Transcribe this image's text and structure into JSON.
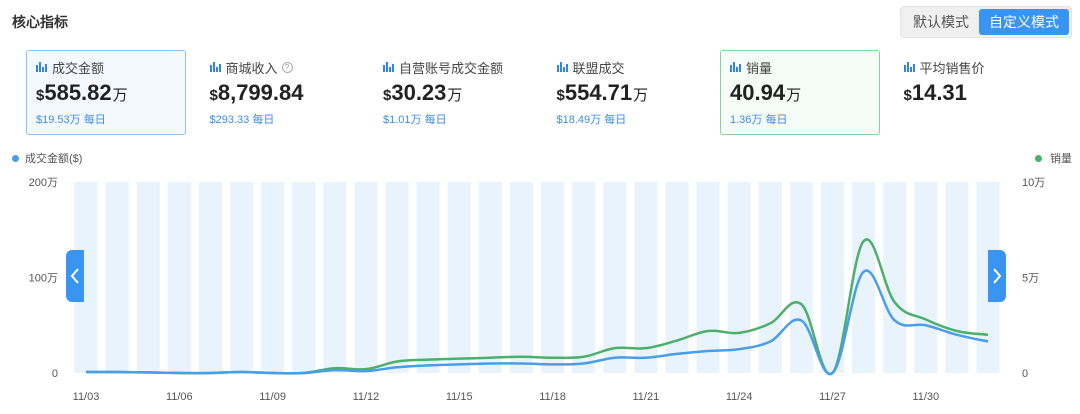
{
  "header": {
    "title": "核心指标"
  },
  "modes": [
    {
      "label": "默认模式",
      "active": false
    },
    {
      "label": "自定义模式",
      "active": true
    }
  ],
  "metrics": [
    {
      "label": "成交金额",
      "currency": "$",
      "value": "585.82",
      "unit": "万",
      "sub": "$19.53万 每日",
      "selected": "blue",
      "help": false
    },
    {
      "label": "商城收入",
      "currency": "$",
      "value": "8,799.84",
      "unit": "",
      "sub": "$293.33 每日",
      "selected": "",
      "help": true
    },
    {
      "label": "自营账号成交金额",
      "currency": "$",
      "value": "30.23",
      "unit": "万",
      "sub": "$1.01万 每日",
      "selected": "",
      "help": false
    },
    {
      "label": "联盟成交",
      "currency": "$",
      "value": "554.71",
      "unit": "万",
      "sub": "$18.49万 每日",
      "selected": "",
      "help": false
    },
    {
      "label": "销量",
      "currency": "",
      "value": "40.94",
      "unit": "万",
      "sub": "1.36万 每日",
      "selected": "green",
      "help": false
    },
    {
      "label": "平均销售价",
      "currency": "$",
      "value": "14.31",
      "unit": "",
      "sub": "",
      "selected": "",
      "help": false
    }
  ],
  "legend": {
    "left": {
      "label": "成交金额($)",
      "color": "#4a9de8"
    },
    "right": {
      "label": "销量",
      "color": "#4caf6a"
    }
  },
  "icons": {
    "metric": "bar-chart-icon",
    "help": "question-circle-icon",
    "prev": "chevron-left-icon",
    "next": "chevron-right-icon"
  },
  "chart_data": {
    "type": "line",
    "x": [
      "11/03",
      "11/04",
      "11/05",
      "11/06",
      "11/07",
      "11/08",
      "11/09",
      "11/10",
      "11/11",
      "11/12",
      "11/13",
      "11/14",
      "11/15",
      "11/16",
      "11/17",
      "11/18",
      "11/19",
      "11/20",
      "11/21",
      "11/22",
      "11/23",
      "11/24",
      "11/25",
      "11/26",
      "11/27",
      "11/28",
      "11/29",
      "11/30",
      "12/01",
      "12/02"
    ],
    "x_tick_labels": [
      "11/03",
      "11/06",
      "11/09",
      "11/12",
      "11/15",
      "11/18",
      "11/21",
      "11/24",
      "11/27",
      "11/30"
    ],
    "y_left": {
      "label": "成交金额($)",
      "ticks": [
        "0",
        "100万",
        "200万"
      ],
      "ylim": [
        0,
        200
      ]
    },
    "y_right": {
      "label": "销量",
      "ticks": [
        "0",
        "5万",
        "10万"
      ],
      "ylim": [
        0,
        10
      ]
    },
    "series": [
      {
        "name": "成交金额($)",
        "axis": "left",
        "color": "#4a9de8",
        "values": [
          1,
          1,
          0.5,
          0,
          0,
          1,
          0,
          0,
          3,
          2,
          6,
          8,
          9,
          10,
          10,
          9,
          10,
          16,
          16,
          20,
          23,
          25,
          33,
          55,
          0,
          106,
          55,
          50,
          40,
          33
        ]
      },
      {
        "name": "销量",
        "axis": "right",
        "color": "#4caf6a",
        "values": [
          0.05,
          0.05,
          0.03,
          0,
          0,
          0.05,
          0,
          0,
          0.25,
          0.2,
          0.6,
          0.7,
          0.75,
          0.8,
          0.85,
          0.8,
          0.85,
          1.3,
          1.3,
          1.7,
          2.2,
          2.1,
          2.6,
          3.6,
          0,
          6.9,
          3.7,
          2.8,
          2.2,
          2.0
        ]
      }
    ],
    "grid": true,
    "legend_position": "top"
  }
}
